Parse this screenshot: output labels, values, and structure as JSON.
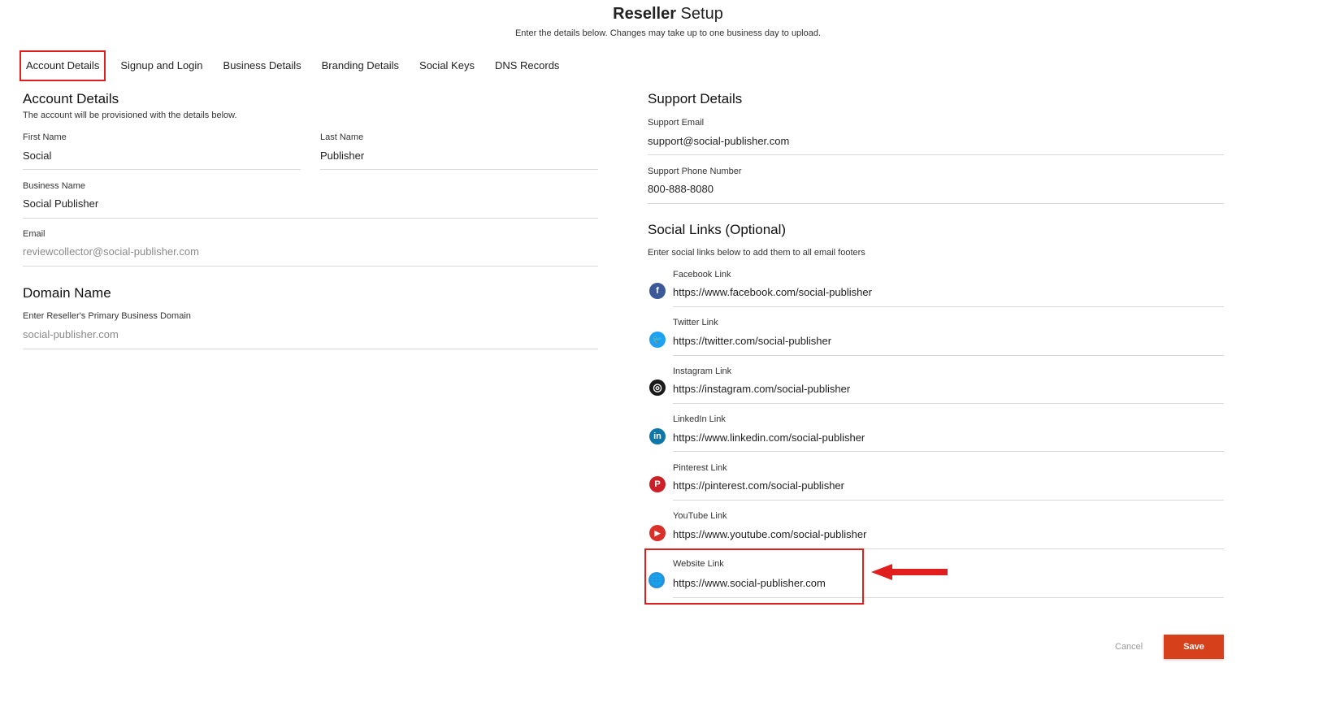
{
  "header": {
    "title_bold": "Reseller",
    "title_rest": " Setup",
    "subtitle": "Enter the details below. Changes may take up to one business day to upload."
  },
  "tabs": [
    {
      "label": "Account Details",
      "active": true
    },
    {
      "label": "Signup and Login"
    },
    {
      "label": "Business Details"
    },
    {
      "label": "Branding Details"
    },
    {
      "label": "Social Keys"
    },
    {
      "label": "DNS Records"
    }
  ],
  "account": {
    "heading": "Account Details",
    "description": "The account will be provisioned with the details below.",
    "first_name": {
      "label": "First Name",
      "value": "Social"
    },
    "last_name": {
      "label": "Last Name",
      "value": "Publisher"
    },
    "business_name": {
      "label": "Business Name",
      "value": "Social Publisher"
    },
    "email": {
      "label": "Email",
      "value": "reviewcollector@social-publisher.com"
    }
  },
  "domain": {
    "heading": "Domain Name",
    "label": "Enter Reseller's Primary Business Domain",
    "value": "social-publisher.com"
  },
  "support": {
    "heading": "Support Details",
    "email": {
      "label": "Support Email",
      "value": "support@social-publisher.com"
    },
    "phone": {
      "label": "Support Phone Number",
      "value": "800-888-8080"
    }
  },
  "social": {
    "heading": "Social Links (Optional)",
    "description": "Enter social links below to add them to all email footers",
    "links": [
      {
        "label": "Facebook Link",
        "value": "https://www.facebook.com/social-publisher",
        "icon": "facebook-icon",
        "glyph": "f",
        "color": "#3b5998"
      },
      {
        "label": "Twitter Link",
        "value": "https://twitter.com/social-publisher",
        "icon": "twitter-icon",
        "glyph": "🐦",
        "color": "#1da1f2"
      },
      {
        "label": "Instagram Link",
        "value": "https://instagram.com/social-publisher",
        "icon": "instagram-icon",
        "glyph": "◎",
        "color": "#1a1a1a"
      },
      {
        "label": "LinkedIn Link",
        "value": "https://www.linkedin.com/social-publisher",
        "icon": "linkedin-icon",
        "glyph": "in",
        "color": "#0e76a8"
      },
      {
        "label": "Pinterest Link",
        "value": "https://pinterest.com/social-publisher",
        "icon": "pinterest-icon",
        "glyph": "P",
        "color": "#cb2027"
      },
      {
        "label": "YouTube Link",
        "value": "https://www.youtube.com/social-publisher",
        "icon": "youtube-icon",
        "glyph": "▶",
        "color": "#d9302a"
      },
      {
        "label": "Website Link",
        "value": "https://www.social-publisher.com",
        "icon": "globe-icon",
        "glyph": "🌐",
        "color": "#2a8fd6"
      }
    ]
  },
  "actions": {
    "cancel": "Cancel",
    "save": "Save"
  },
  "colors": {
    "accent": "#d6401a",
    "highlight": "#e01e1e"
  }
}
